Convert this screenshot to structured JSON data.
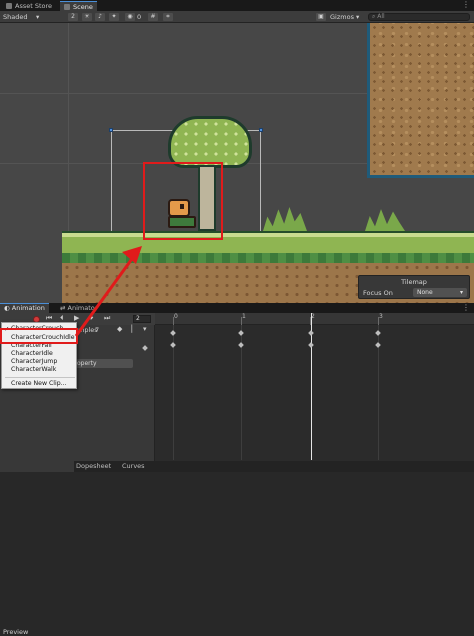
{
  "tabs": {
    "asset_store": "Asset Store",
    "scene": "Scene"
  },
  "toolbar": {
    "shading_mode": "Shaded",
    "gizmos": "Gizmos",
    "search_placeholder": "All",
    "hidden_count": "0"
  },
  "tilemap": {
    "title": "Tilemap",
    "focus_label": "Focus On",
    "focus_value": "None"
  },
  "animation": {
    "tab_label": "Animation",
    "animator_tab_label": "Animator",
    "preview_label": "Preview",
    "samples_label": "mples",
    "samples_value": "7",
    "frame_value": "2",
    "add_property_label": "operty",
    "timeline_ticks": [
      "0",
      "1",
      "2",
      "3"
    ],
    "bottom_tabs": {
      "dopesheet": "Dopesheet",
      "curves": "Curves"
    }
  },
  "clip_menu": {
    "items": [
      "CharacterCrouch",
      "CharacterCrouchIdle",
      "CharacterFall",
      "CharacterIdle",
      "CharacterJump",
      "CharacterWalk"
    ],
    "selected": "CharacterCrouch",
    "create_label": "Create New Clip..."
  },
  "colors": {
    "highlight": "#e01b1b",
    "accent": "#4a8fd8"
  }
}
